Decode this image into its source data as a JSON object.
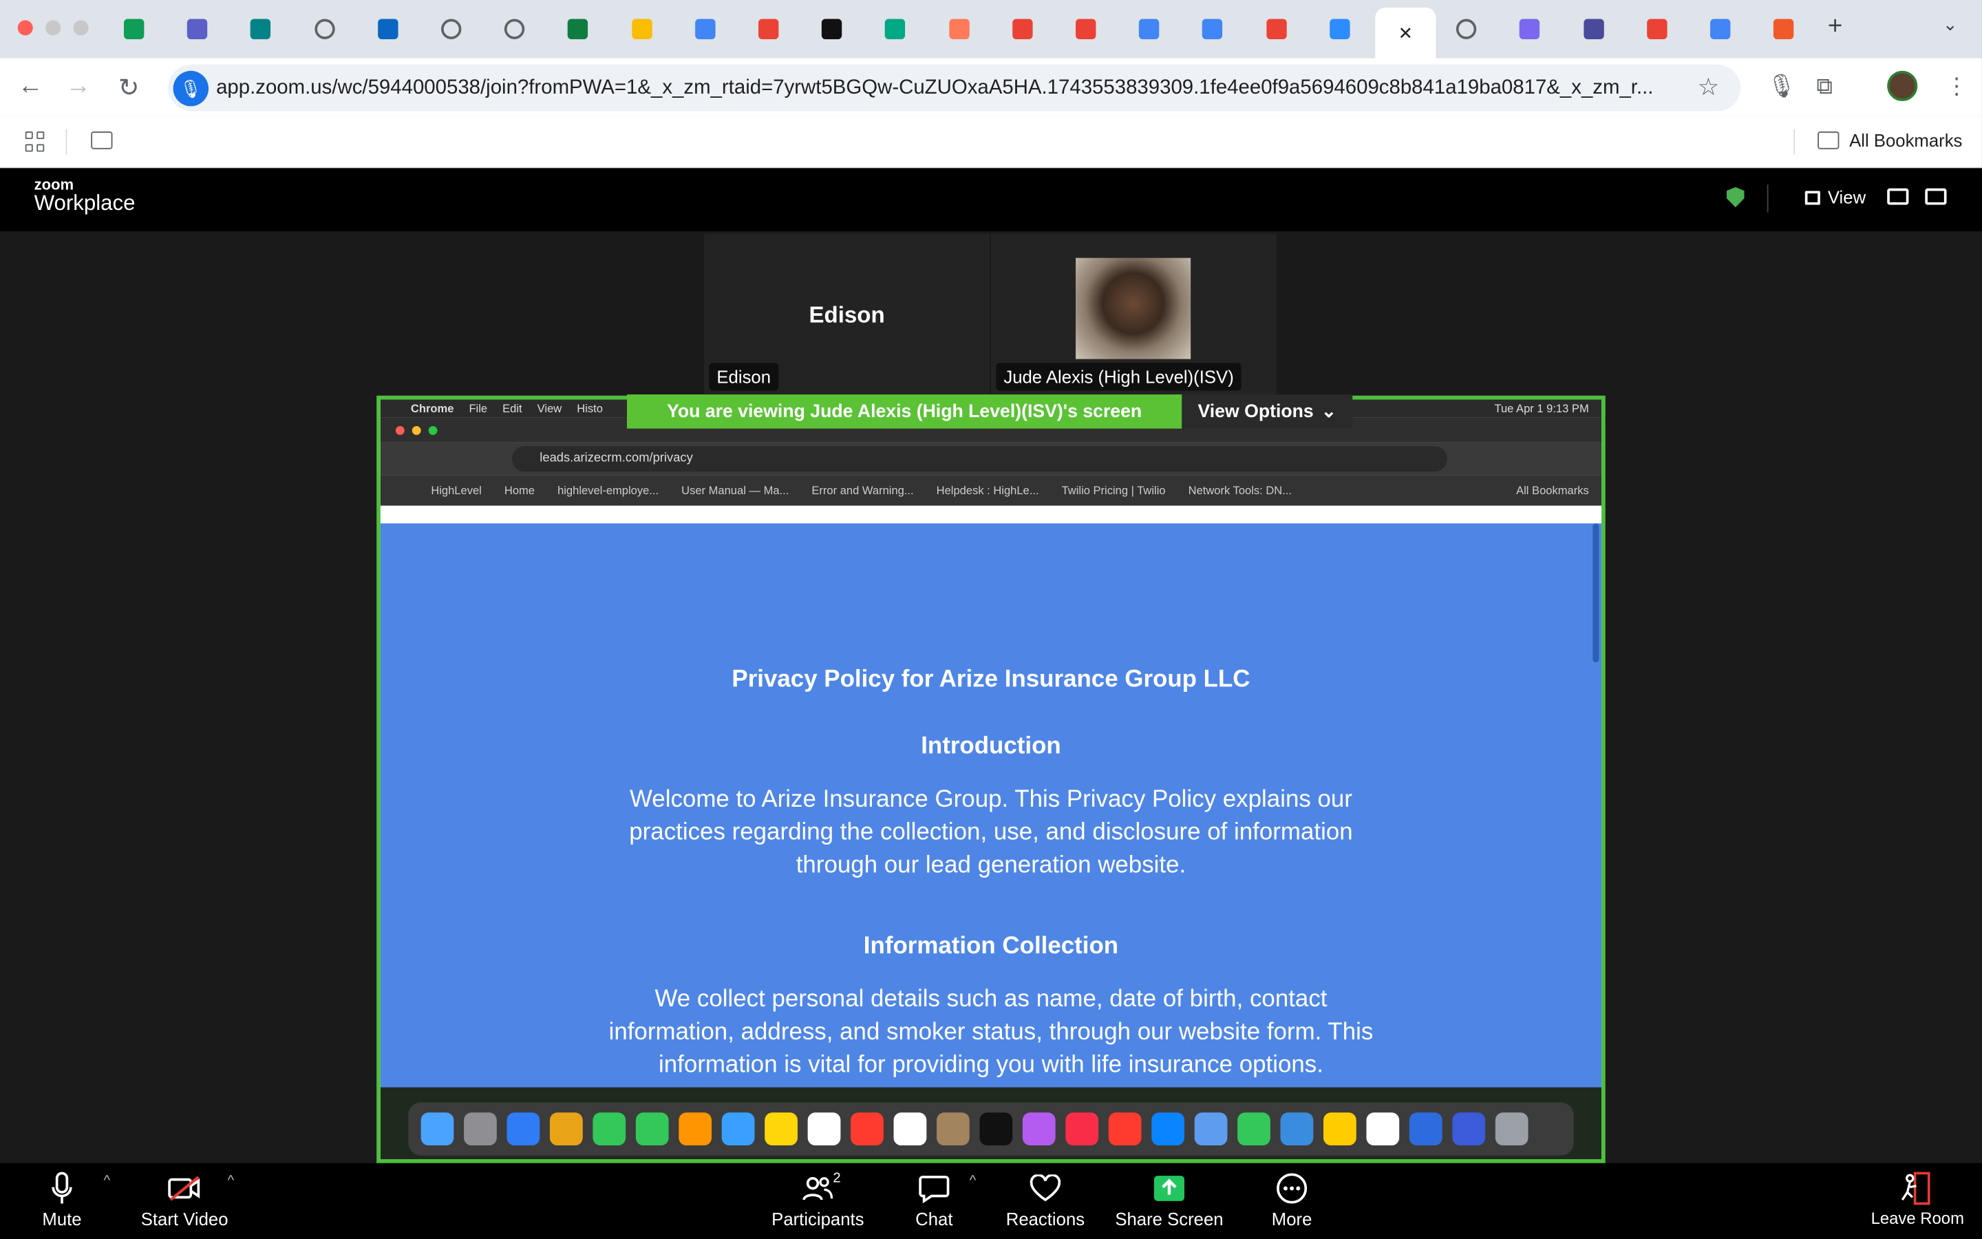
{
  "browser": {
    "url": "app.zoom.us/wc/5944000538/join?fromPWA=1&_x_zm_rtaid=7yrwt5BGQw-CuZUOxaA5HA.1743553839309.1fe4ee0f9a5694609c8b841a19ba0817&_x_zm_r...",
    "tab_icons": [
      "sheets",
      "teams",
      "sharepoint",
      "web",
      "outlook",
      "web",
      "web",
      "excel",
      "drive",
      "docs",
      "google",
      "chatgpt",
      "meet",
      "hubspot",
      "gmail",
      "gmail",
      "docs",
      "docs",
      "google",
      "zoom",
      "active",
      "web",
      "clickup",
      "miro",
      "gmail",
      "docs",
      "clickfunnels"
    ],
    "bookmarks_all": "All Bookmarks"
  },
  "zoom": {
    "brand_small": "zoom",
    "brand_big": "Workplace",
    "view_label": "View",
    "participants": [
      {
        "name": "Edison",
        "label": "Edison"
      },
      {
        "name": "",
        "label": "Jude Alexis (High Level)(ISV)"
      }
    ],
    "viewing_banner": "You are viewing  Jude Alexis (High Level)(ISV)'s screen",
    "view_options": "View Options",
    "footer": {
      "mute": "Mute",
      "start_video": "Start Video",
      "participants": "Participants",
      "participants_count": "2",
      "chat": "Chat",
      "reactions": "Reactions",
      "share_screen": "Share Screen",
      "more": "More",
      "leave": "Leave Room"
    }
  },
  "shared_screen": {
    "mac_menu": [
      "Chrome",
      "File",
      "Edit",
      "View",
      "Histo"
    ],
    "mac_clock": "Tue Apr 1  9:13 PM",
    "inner_url": "leads.arizecrm.com/privacy",
    "inner_bookmarks": [
      "HighLevel",
      "Home",
      "highlevel-employe...",
      "User Manual — Ma...",
      "Error and Warning...",
      "Helpdesk : HighLe...",
      "Twilio Pricing | Twilio",
      "Network Tools: DN..."
    ],
    "inner_all_bookmarks": "All Bookmarks",
    "page": {
      "title": "Privacy Policy for Arize Insurance Group LLC",
      "h_intro": "Introduction",
      "intro": "Welcome to Arize Insurance Group. This Privacy Policy explains our practices regarding the collection, use, and disclosure of information through our lead generation website.",
      "h_collection": "Information Collection",
      "collection": "We collect personal details such as name, date of birth, contact information, address, and smoker status, through our website form. This information is vital for providing you with life insurance options."
    }
  },
  "colors": {
    "share_border": "#4cc13a",
    "page_blue": "#4f86e6",
    "leave_red": "#e53935",
    "share_green": "#22c55e"
  }
}
